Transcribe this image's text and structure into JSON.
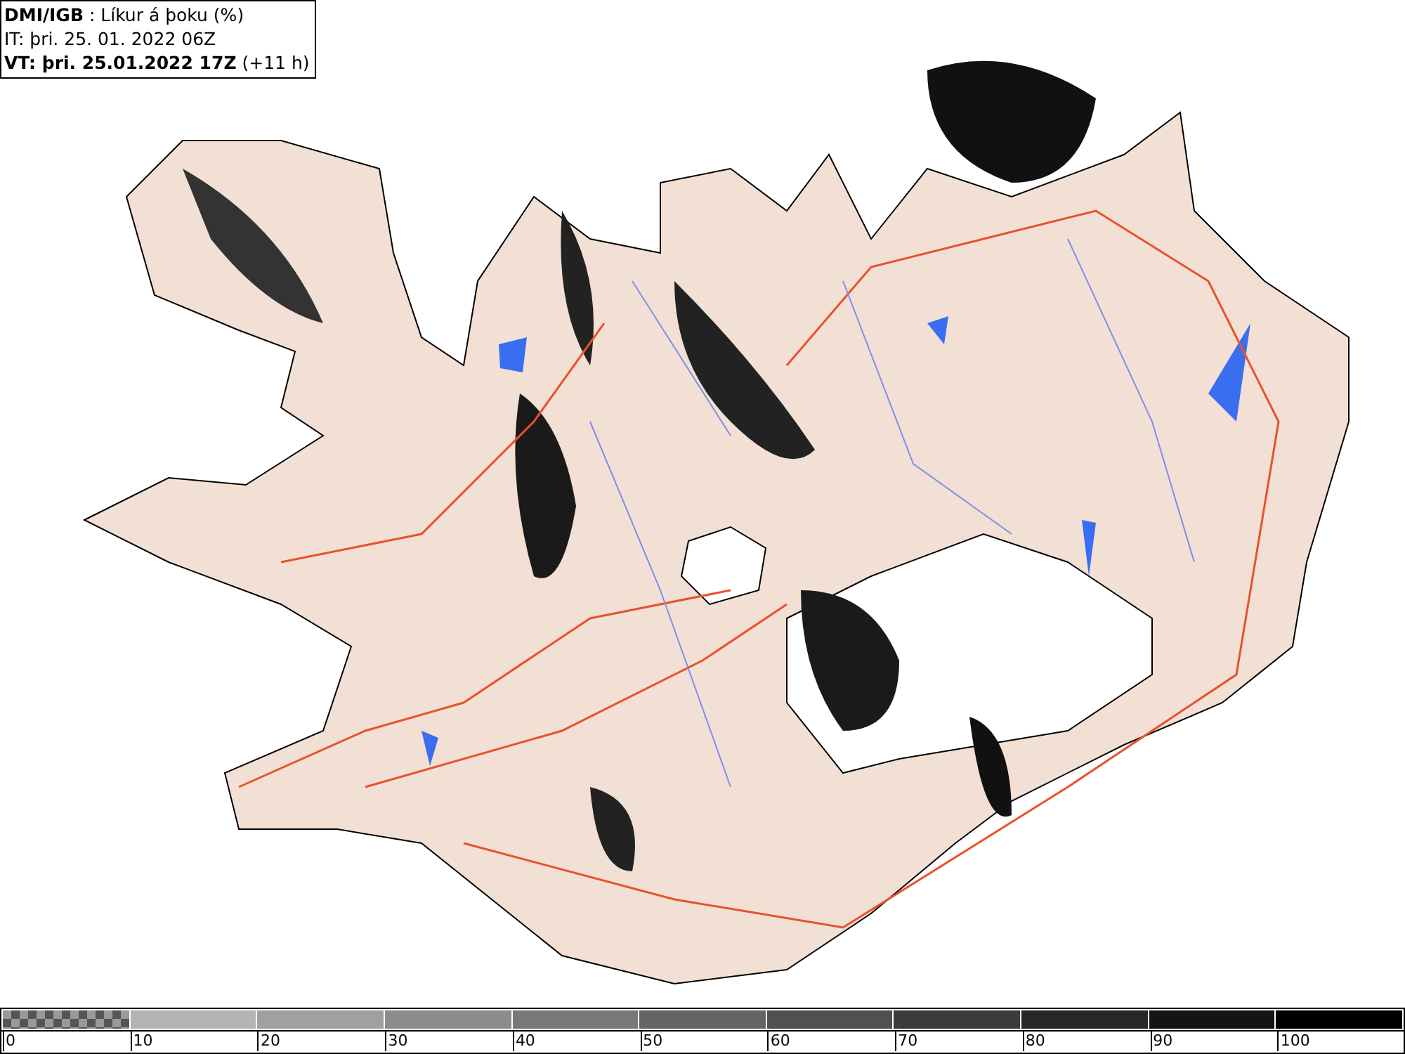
{
  "header": {
    "lines": [
      "**DMI/IGB** : Líkur á þoku (%)",
      "IT: þri. 25. 01. 2022 06Z",
      "**VT: þri. 25.01.2022 17Z** (+11 h)"
    ]
  },
  "legend": {
    "bins": [
      {
        "kind": "checker",
        "label": "0"
      },
      {
        "kind": "solid",
        "color": "#b4b4b4",
        "label": "10"
      },
      {
        "kind": "solid",
        "color": "#a0a0a0",
        "label": "20"
      },
      {
        "kind": "solid",
        "color": "#8c8c8c",
        "label": "30"
      },
      {
        "kind": "solid",
        "color": "#787878",
        "label": "40"
      },
      {
        "kind": "solid",
        "color": "#646464",
        "label": "50"
      },
      {
        "kind": "solid",
        "color": "#505050",
        "label": "60"
      },
      {
        "kind": "solid",
        "color": "#3c3c3c",
        "label": "70"
      },
      {
        "kind": "solid",
        "color": "#282828",
        "label": "80"
      },
      {
        "kind": "solid",
        "color": "#141414",
        "label": "90"
      },
      {
        "kind": "solid",
        "color": "#000000",
        "label": "100"
      }
    ]
  }
}
